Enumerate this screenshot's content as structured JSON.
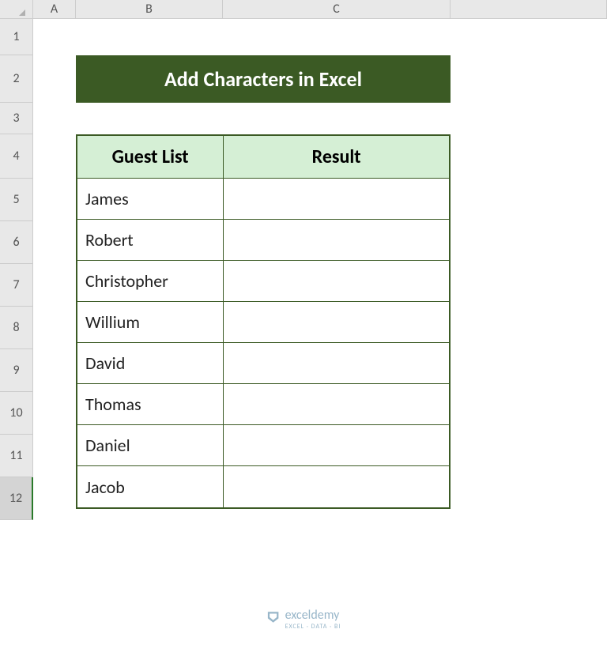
{
  "columns": {
    "a": "A",
    "b": "B",
    "c": "C"
  },
  "rows": [
    "1",
    "2",
    "3",
    "4",
    "5",
    "6",
    "7",
    "8",
    "9",
    "10",
    "11",
    "12"
  ],
  "activeRow": "12",
  "banner": {
    "title": "Add Characters in Excel"
  },
  "table": {
    "headers": {
      "guest": "Guest List",
      "result": "Result"
    },
    "data": [
      {
        "guest": "James",
        "result": ""
      },
      {
        "guest": "Robert",
        "result": ""
      },
      {
        "guest": "Christopher",
        "result": ""
      },
      {
        "guest": "Willium",
        "result": ""
      },
      {
        "guest": "David",
        "result": ""
      },
      {
        "guest": "Thomas",
        "result": ""
      },
      {
        "guest": "Daniel",
        "result": ""
      },
      {
        "guest": "Jacob",
        "result": ""
      }
    ]
  },
  "watermark": {
    "name": "exceldemy",
    "tagline": "EXCEL · DATA · BI"
  },
  "chart_data": {
    "type": "table",
    "title": "Add Characters in Excel",
    "columns": [
      "Guest List",
      "Result"
    ],
    "rows": [
      [
        "James",
        ""
      ],
      [
        "Robert",
        ""
      ],
      [
        "Christopher",
        ""
      ],
      [
        "Willium",
        ""
      ],
      [
        "David",
        ""
      ],
      [
        "Thomas",
        ""
      ],
      [
        "Daniel",
        ""
      ],
      [
        "Jacob",
        ""
      ]
    ]
  }
}
